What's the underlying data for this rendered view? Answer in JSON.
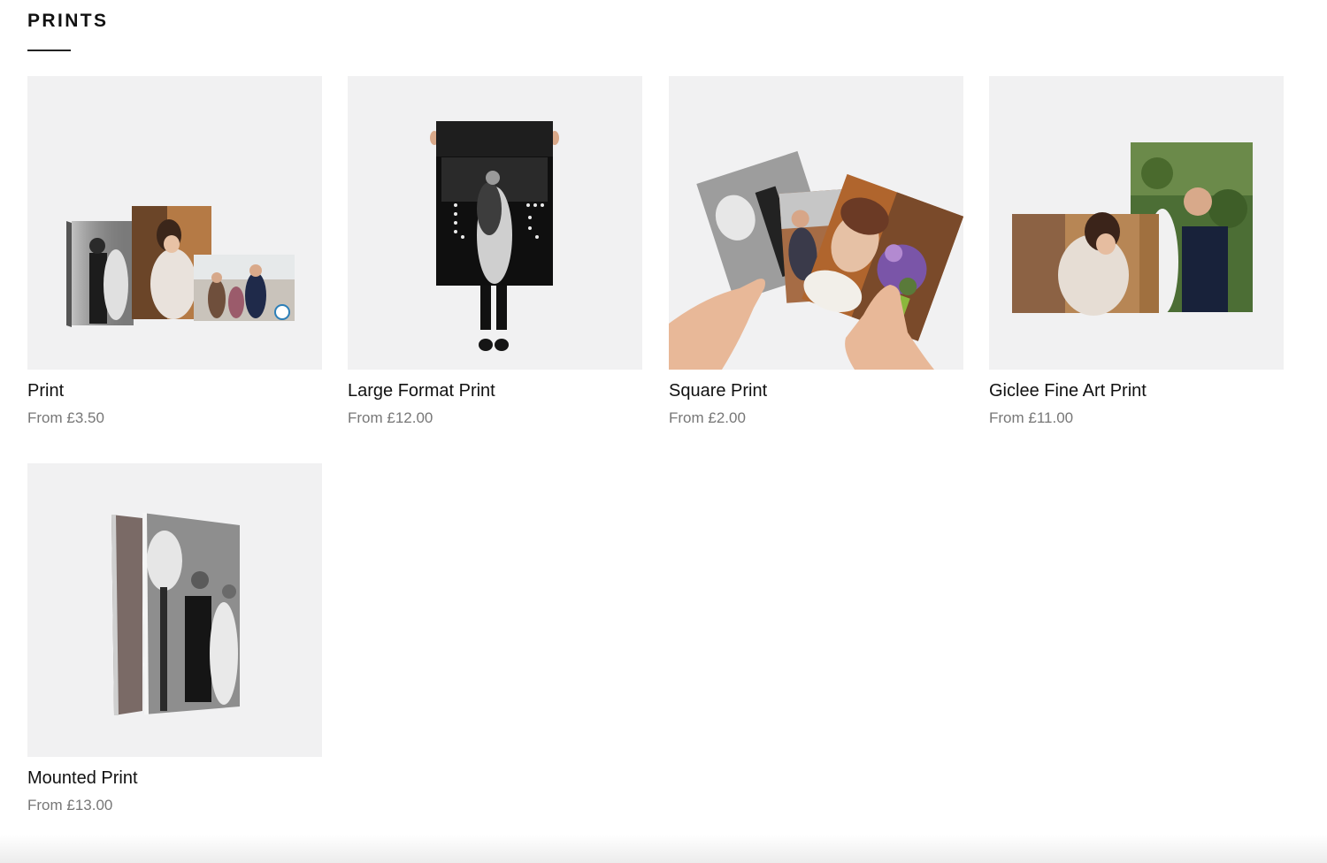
{
  "section": {
    "title": "PRINTS"
  },
  "products": [
    {
      "name": "Print",
      "price": "From £3.50",
      "image": "print-stack-photo"
    },
    {
      "name": "Large Format Print",
      "price": "From £12.00",
      "image": "large-format-print-photo"
    },
    {
      "name": "Square Print",
      "price": "From £2.00",
      "image": "square-print-photo"
    },
    {
      "name": "Giclee Fine Art Print",
      "price": "From £11.00",
      "image": "giclee-print-photo"
    },
    {
      "name": "Mounted Print",
      "price": "From £13.00",
      "image": "mounted-print-photo"
    }
  ],
  "colors": {
    "text": "#111111",
    "price": "#777777",
    "thumb_background": "#f1f1f2",
    "rule": "#222222"
  }
}
